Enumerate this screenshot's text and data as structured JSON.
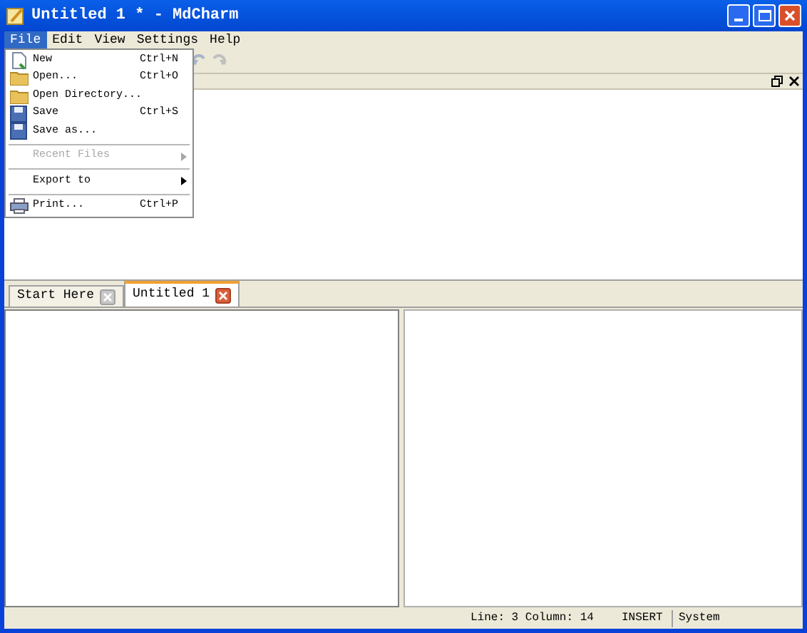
{
  "window": {
    "title": "Untitled 1 * - MdCharm"
  },
  "menubar": [
    {
      "label": "File",
      "selected": true
    },
    {
      "label": "Edit",
      "selected": false
    },
    {
      "label": "View",
      "selected": false
    },
    {
      "label": "Settings",
      "selected": false
    },
    {
      "label": "Help",
      "selected": false
    }
  ],
  "file_menu": [
    {
      "kind": "item",
      "label": "New",
      "shortcut": "Ctrl+N",
      "disabled": false,
      "submenu": false
    },
    {
      "kind": "item",
      "label": "Open...",
      "shortcut": "Ctrl+O",
      "disabled": false,
      "submenu": false
    },
    {
      "kind": "item",
      "label": "Open Directory...",
      "disabled": false,
      "submenu": false
    },
    {
      "kind": "item",
      "label": "Save",
      "shortcut": "Ctrl+S",
      "disabled": false,
      "submenu": false
    },
    {
      "kind": "item",
      "label": "Save as...",
      "disabled": false,
      "submenu": false
    },
    {
      "kind": "separator"
    },
    {
      "kind": "item",
      "label": "Recent Files",
      "disabled": true,
      "submenu": true
    },
    {
      "kind": "separator"
    },
    {
      "kind": "item",
      "label": "Export to",
      "disabled": false,
      "submenu": true
    },
    {
      "kind": "separator"
    },
    {
      "kind": "item",
      "label": "Print...",
      "shortcut": "Ctrl+P",
      "disabled": false,
      "submenu": false
    }
  ],
  "tabs": [
    {
      "label": "Start Here",
      "selected": false
    },
    {
      "label": "Untitled 1",
      "selected": true
    }
  ],
  "status_bar": {
    "position": "Line: 3 Column: 14",
    "mode": "INSERT",
    "encoding": "System"
  }
}
